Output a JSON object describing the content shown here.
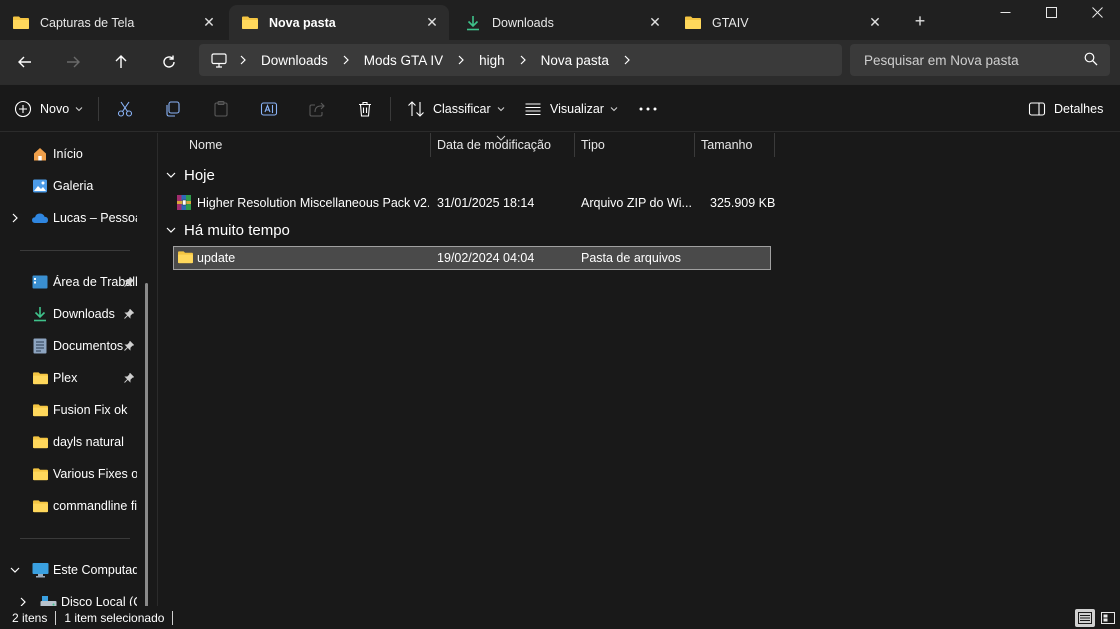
{
  "tabs": [
    {
      "label": "Capturas de Tela",
      "icon": "folder-icon"
    },
    {
      "label": "Nova pasta",
      "icon": "folder-icon"
    },
    {
      "label": "Downloads",
      "icon": "download-icon"
    },
    {
      "label": "GTAIV",
      "icon": "folder-icon"
    }
  ],
  "breadcrumb": [
    "Downloads",
    "Mods GTA IV",
    "high",
    "Nova pasta"
  ],
  "search": {
    "placeholder": "Pesquisar em Nova pasta"
  },
  "toolbar": {
    "new_label": "Novo",
    "sort_label": "Classificar",
    "view_label": "Visualizar",
    "details_label": "Detalhes"
  },
  "nav": {
    "home": "Início",
    "gallery": "Galeria",
    "onedrive": "Lucas – Pessoal",
    "desktop": "Área de Trabalho",
    "downloads": "Downloads",
    "documents": "Documentos",
    "plex": "Plex",
    "fusion": "Fusion Fix ok",
    "dayls": "dayls natural",
    "various": "Various Fixes ok",
    "commandline": "commandline fix",
    "thispc": "Este Computador",
    "localdisk": "Disco Local (C:)"
  },
  "columns": {
    "name": "Nome",
    "date": "Data de modificação",
    "type": "Tipo",
    "size": "Tamanho"
  },
  "groups": {
    "today": {
      "label": "Hoje",
      "rows": [
        {
          "name": "Higher Resolution Miscellaneous Pack v2...",
          "date": "31/01/2025 18:14",
          "type": "Arquivo ZIP do Wi...",
          "size": "325.909 KB"
        }
      ]
    },
    "longago": {
      "label": "Há muito tempo",
      "rows": [
        {
          "name": "update",
          "date": "19/02/2024 04:04",
          "type": "Pasta de arquivos",
          "size": ""
        }
      ]
    }
  },
  "status": {
    "count": "2 itens",
    "selected": "1 item selecionado"
  },
  "colors": {
    "folder": "#f4c542",
    "accent": "#4cc2ff",
    "download": "#3fc28b"
  }
}
